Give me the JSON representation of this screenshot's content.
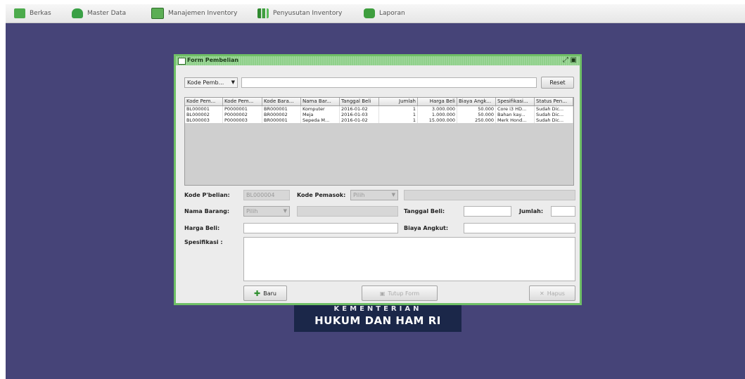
{
  "menubar": {
    "items": [
      {
        "label": "Berkas",
        "icon": "folder-icon"
      },
      {
        "label": "Master Data",
        "icon": "database-icon"
      },
      {
        "label": "Manajemen Inventory",
        "icon": "monitor-icon"
      },
      {
        "label": "Penyusutan Inventory",
        "icon": "chart-icon"
      },
      {
        "label": "Laporan",
        "icon": "printer-icon"
      }
    ]
  },
  "logo": {
    "line1": "KEMENTERIAN",
    "line2": "HUKUM DAN HAM RI"
  },
  "form": {
    "title": "Form Pembelian",
    "search": {
      "combo_value": "Kode Pemb...",
      "input_value": "",
      "reset_label": "Reset"
    },
    "table": {
      "columns": [
        "Kode Pem...",
        "Kode Pem...",
        "Kode Bara...",
        "Nama Bar...",
        "Tanggal Beli",
        "Jumlah",
        "Harga Beli",
        "Biaya Angk...",
        "Spesifikasi...",
        "Status Pen..."
      ],
      "rows": [
        [
          "BL000001",
          "P0000001",
          "BR000001",
          "Komputer",
          "2016-01-02",
          "1",
          "3.000.000",
          "50.000",
          "Core i3 HD...",
          "Sudah Dic..."
        ],
        [
          "BL000002",
          "P0000002",
          "BR000002",
          "Meja",
          "2016-01-03",
          "1",
          "1.000.000",
          "50.000",
          "Bahan kay...",
          "Sudah Dic..."
        ],
        [
          "BL000003",
          "P0000003",
          "BR000001",
          "Sepeda M...",
          "2016-01-02",
          "1",
          "15.000.000",
          "250.000",
          "Merk Hond...",
          "Sudah Dic..."
        ]
      ]
    },
    "labels": {
      "kode_pembelian": "Kode P'belian:",
      "kode_pemasok": "Kode Pemasok:",
      "nama_barang": "Nama Barang:",
      "tanggal_beli": "Tanggal Beli:",
      "jumlah": "Jumlah:",
      "harga_beli": "Harga Beli:",
      "biaya_angkut": "Biaya Angkut:",
      "spesifikasi": "Spesifikasi :"
    },
    "values": {
      "kode_pembelian": "BL000004",
      "kode_pemasok": "Pilih",
      "nama_barang": "Pilih"
    },
    "buttons": {
      "baru": "Baru",
      "simpan": "Tutup Form",
      "hapus": "Hapus"
    },
    "colors": {
      "frame_green": "#6fbf66",
      "desktop": "#464478"
    }
  }
}
